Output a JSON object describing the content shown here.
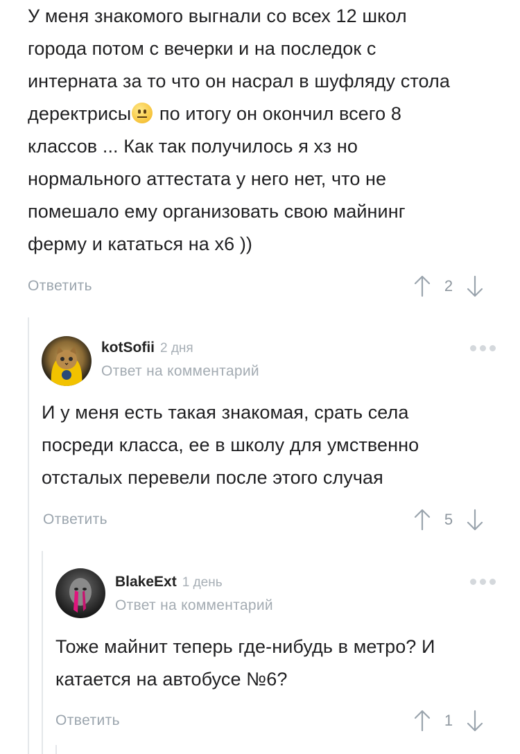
{
  "root_comment": {
    "lines": [
      "У меня знакомого выгнали со всех 12 школ",
      "города потом с вечерки и на последок с",
      "интерната за то что он насрал в шуфляду стола",
      "деректрисы",
      " по итогу он окончил всего 8",
      "классов ... Как так получилось я хз но",
      "нормального аттестата у него нет, что не",
      "помешало ему организовать свою майнинг",
      "ферму и кататься на х6 ))"
    ],
    "reply_label": "Ответить",
    "votes": "2"
  },
  "reply1": {
    "author": "kotSofii",
    "time": "2 дня",
    "reply_to": "Ответ на комментарий",
    "lines": [
      "И у меня есть такая знакомая, срать села",
      "посреди класса, ее в школу для умственно",
      "отсталых перевели после этого случая"
    ],
    "reply_label": "Ответить",
    "votes": "5"
  },
  "reply2": {
    "author": "BlakeExt",
    "time": "1 день",
    "reply_to": "Ответ на комментарий",
    "lines": [
      "Тоже майнит теперь где-нибудь в метро? И",
      "катается на автобусе №6?"
    ],
    "reply_label": "Ответить",
    "votes": "1"
  },
  "icons": {
    "upvote": "arrow-up-icon",
    "downvote": "arrow-down-icon",
    "more": "more-dots-icon",
    "emoji": "neutral-face-emoji"
  },
  "colors": {
    "muted": "#9aa4ad",
    "thread_line": "#e4e7ea",
    "text": "#1f1f21"
  }
}
